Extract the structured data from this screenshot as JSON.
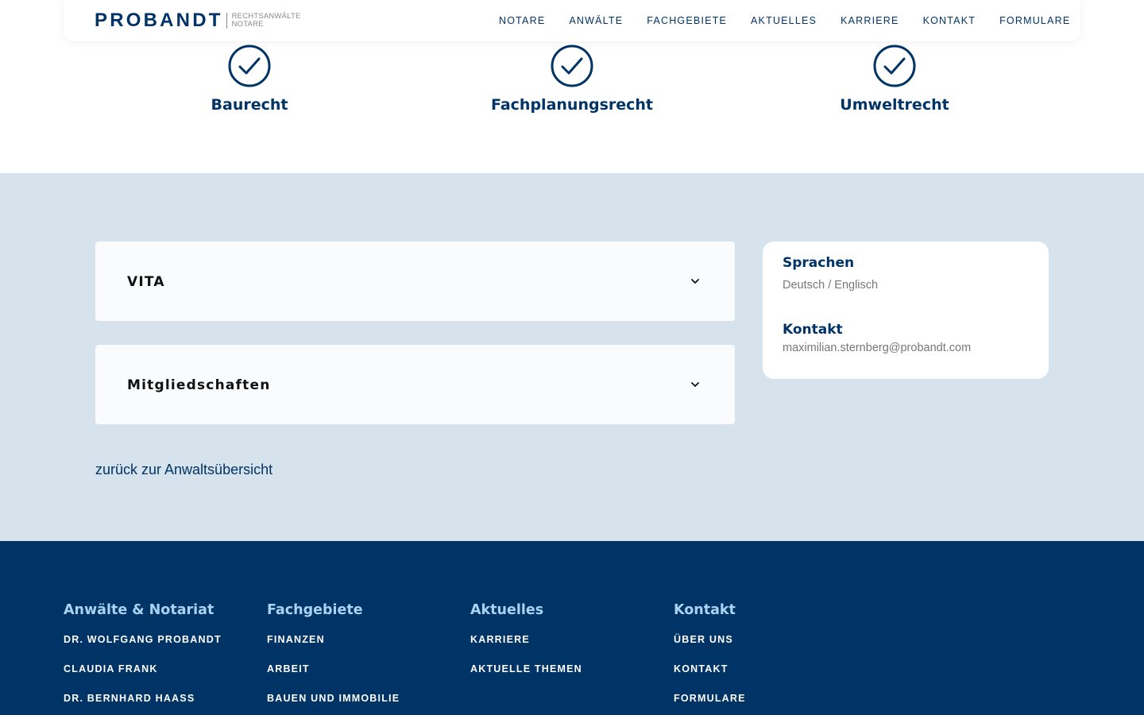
{
  "header": {
    "logo_main": "PROBANDT",
    "logo_sub_1": "RECHTSANWÄLTE",
    "logo_sub_2": "NOTARE",
    "nav": [
      "NOTARE",
      "ANWÄLTE",
      "FACHGEBIETE",
      "AKTUELLES",
      "KARRIERE",
      "KONTAKT",
      "FORMULARE"
    ]
  },
  "areas": [
    {
      "label": "Baurecht",
      "icon": "check-circle-icon"
    },
    {
      "label": "Fachplanungsrecht",
      "icon": "check-circle-icon"
    },
    {
      "label": "Umweltrecht",
      "icon": "check-circle-icon"
    }
  ],
  "accordions": [
    {
      "title": "VITA",
      "icon": "chevron-down-icon"
    },
    {
      "title": "Mitgliedschaften",
      "icon": "chevron-down-icon"
    }
  ],
  "side_card": {
    "languages_heading": "Sprachen",
    "languages_value": "Deutsch / Englisch",
    "contact_heading": "Kontakt",
    "contact_value": "maximilian.sternberg@probandt.com"
  },
  "back_link": "zurück zur Anwaltsübersicht",
  "footer": {
    "columns": [
      {
        "heading": "Anwälte & Notariat",
        "links": [
          "DR. WOLFGANG PROBANDT",
          "CLAUDIA FRANK",
          "DR. BERNHARD HAASS"
        ]
      },
      {
        "heading": "Fachgebiete",
        "links": [
          "FINANZEN",
          "ARBEIT",
          "BAUEN UND IMMOBILIE"
        ]
      },
      {
        "heading": "Aktuelles",
        "links": [
          "KARRIERE",
          "AKTUELLE THEMEN"
        ]
      },
      {
        "heading": "Kontakt",
        "links": [
          "ÜBER UNS",
          "KONTAKT",
          "FORMULARE"
        ]
      }
    ]
  },
  "colors": {
    "brand": "#003366",
    "section_bg": "#d6e3ec",
    "footer_heading": "#a9d3f0"
  }
}
